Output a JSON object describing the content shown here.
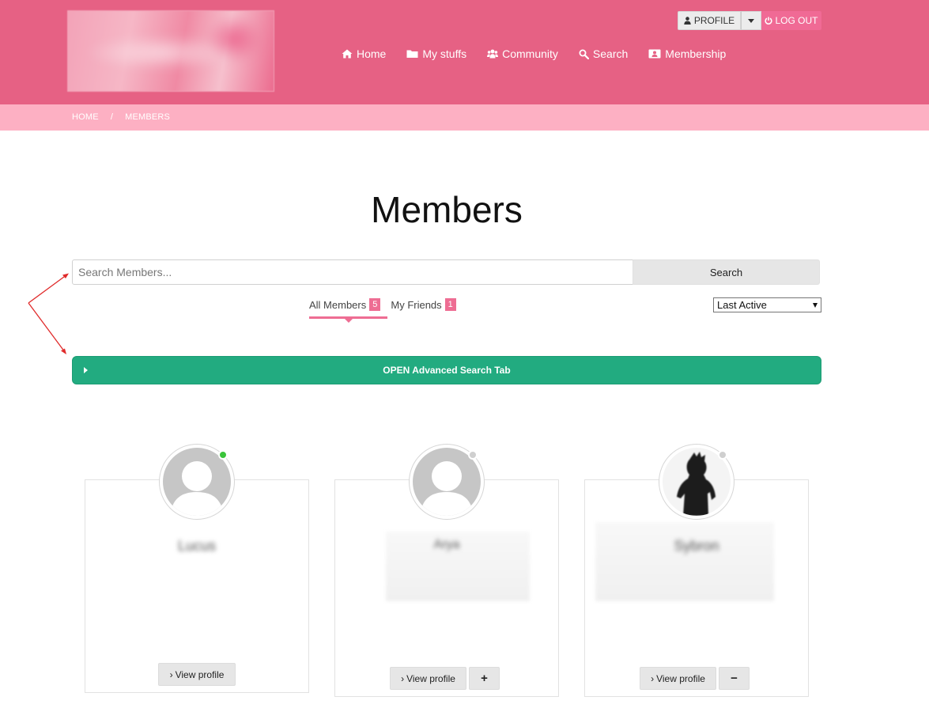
{
  "header": {
    "user_menu": {
      "profile_label": "PROFILE",
      "logout_label": "LOG OUT"
    },
    "nav": [
      {
        "label": "Home",
        "icon": "home-icon"
      },
      {
        "label": "My stuffs",
        "icon": "folder-icon"
      },
      {
        "label": "Community",
        "icon": "users-icon"
      },
      {
        "label": "Search",
        "icon": "search-icon"
      },
      {
        "label": "Membership",
        "icon": "id-card-icon"
      }
    ]
  },
  "breadcrumb": {
    "home": "HOME",
    "separator": "/",
    "current": "MEMBERS"
  },
  "page": {
    "title": "Members"
  },
  "search": {
    "placeholder": "Search Members...",
    "value": "",
    "button_label": "Search"
  },
  "tabs": [
    {
      "label": "All Members",
      "count": "5",
      "active": true
    },
    {
      "label": "My Friends",
      "count": "1",
      "active": false
    }
  ],
  "sort": {
    "selected": "Last Active"
  },
  "advanced_search": {
    "label": "OPEN Advanced Search Tab"
  },
  "members": [
    {
      "name": "Lucus",
      "subtitle": "",
      "online": true,
      "avatar": "default-avatar-icon",
      "view_label": "View profile",
      "action": ""
    },
    {
      "name": "Arya",
      "subtitle": "",
      "online": false,
      "avatar": "default-avatar-icon",
      "view_label": "View profile",
      "action": "+"
    },
    {
      "name": "Sybron",
      "subtitle": "",
      "online": false,
      "avatar": "photo-avatar",
      "view_label": "View profile",
      "action": "−"
    }
  ],
  "colors": {
    "header_bg": "#e66184",
    "breadcrumb_bg": "#fdb0c3",
    "accent_pink": "#ee6d93",
    "advanced_green": "#22ab80",
    "online": "#3ac43a",
    "offline": "#cfcfcf"
  }
}
